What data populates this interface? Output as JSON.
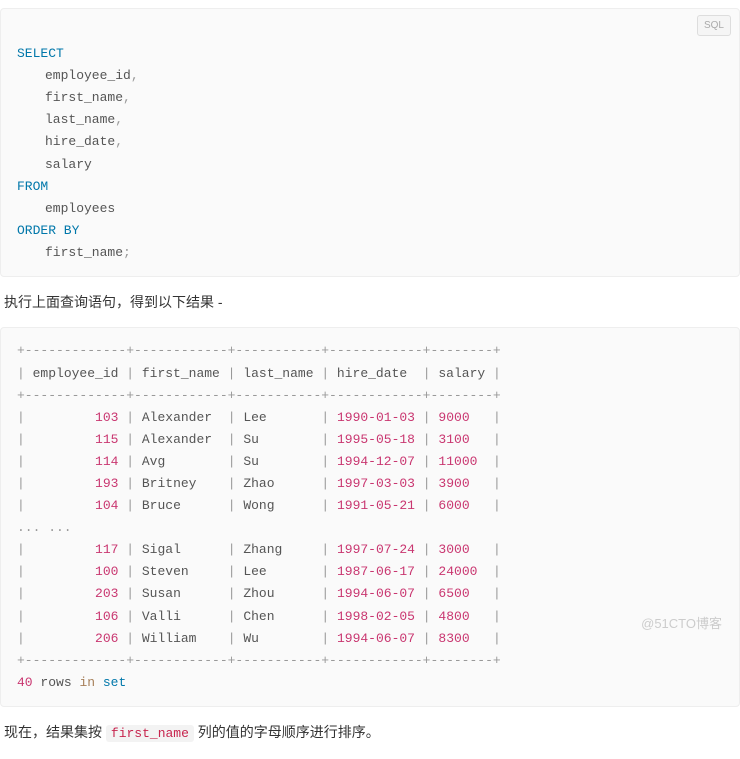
{
  "sql": {
    "lang_label": "SQL",
    "kw_select": "SELECT",
    "cols": [
      "employee_id",
      "first_name",
      "last_name",
      "hire_date",
      "salary"
    ],
    "kw_from": "FROM",
    "table": "employees",
    "kw_orderby": "ORDER BY",
    "order_col": "first_name"
  },
  "prose1_a": "执行上面查询语句，得到以下结果 -",
  "result": {
    "headers": [
      "employee_id",
      "first_name",
      "last_name",
      "hire_date",
      "salary"
    ],
    "rows_top": [
      {
        "id": "103",
        "fn": "Alexander",
        "ln": "Lee",
        "hd": "1990-01-03",
        "sal": "9000"
      },
      {
        "id": "115",
        "fn": "Alexander",
        "ln": "Su",
        "hd": "1995-05-18",
        "sal": "3100"
      },
      {
        "id": "114",
        "fn": "Avg",
        "ln": "Su",
        "hd": "1994-12-07",
        "sal": "11000"
      },
      {
        "id": "193",
        "fn": "Britney",
        "ln": "Zhao",
        "hd": "1997-03-03",
        "sal": "3900"
      },
      {
        "id": "104",
        "fn": "Bruce",
        "ln": "Wong",
        "hd": "1991-05-21",
        "sal": "6000"
      }
    ],
    "ellipsis": "... ...",
    "rows_bottom": [
      {
        "id": "117",
        "fn": "Sigal",
        "ln": "Zhang",
        "hd": "1997-07-24",
        "sal": "3000"
      },
      {
        "id": "100",
        "fn": "Steven",
        "ln": "Lee",
        "hd": "1987-06-17",
        "sal": "24000"
      },
      {
        "id": "203",
        "fn": "Susan",
        "ln": "Zhou",
        "hd": "1994-06-07",
        "sal": "6500"
      },
      {
        "id": "106",
        "fn": "Valli",
        "ln": "Chen",
        "hd": "1998-02-05",
        "sal": "4800"
      },
      {
        "id": "206",
        "fn": "William",
        "ln": "Wu",
        "hd": "1994-06-07",
        "sal": "8300"
      }
    ],
    "footer_count": "40",
    "footer_rows": "rows",
    "footer_in": "in",
    "footer_set": "set"
  },
  "prose2_a": "现在，结果集按 ",
  "prose2_code": "first_name",
  "prose2_b": " 列的值的字母顺序进行排序。",
  "watermark": "@51CTO博客",
  "chart_data": {
    "type": "table",
    "title": "employees ordered by first_name",
    "columns": [
      "employee_id",
      "first_name",
      "last_name",
      "hire_date",
      "salary"
    ],
    "rows": [
      [
        103,
        "Alexander",
        "Lee",
        "1990-01-03",
        9000
      ],
      [
        115,
        "Alexander",
        "Su",
        "1995-05-18",
        3100
      ],
      [
        114,
        "Avg",
        "Su",
        "1994-12-07",
        11000
      ],
      [
        193,
        "Britney",
        "Zhao",
        "1997-03-03",
        3900
      ],
      [
        104,
        "Bruce",
        "Wong",
        "1991-05-21",
        6000
      ],
      [
        117,
        "Sigal",
        "Zhang",
        "1997-07-24",
        3000
      ],
      [
        100,
        "Steven",
        "Lee",
        "1987-06-17",
        24000
      ],
      [
        203,
        "Susan",
        "Zhou",
        "1994-06-07",
        6500
      ],
      [
        106,
        "Valli",
        "Chen",
        "1998-02-05",
        4800
      ],
      [
        206,
        "William",
        "Wu",
        "1994-06-07",
        8300
      ]
    ],
    "total_rows": 40
  }
}
